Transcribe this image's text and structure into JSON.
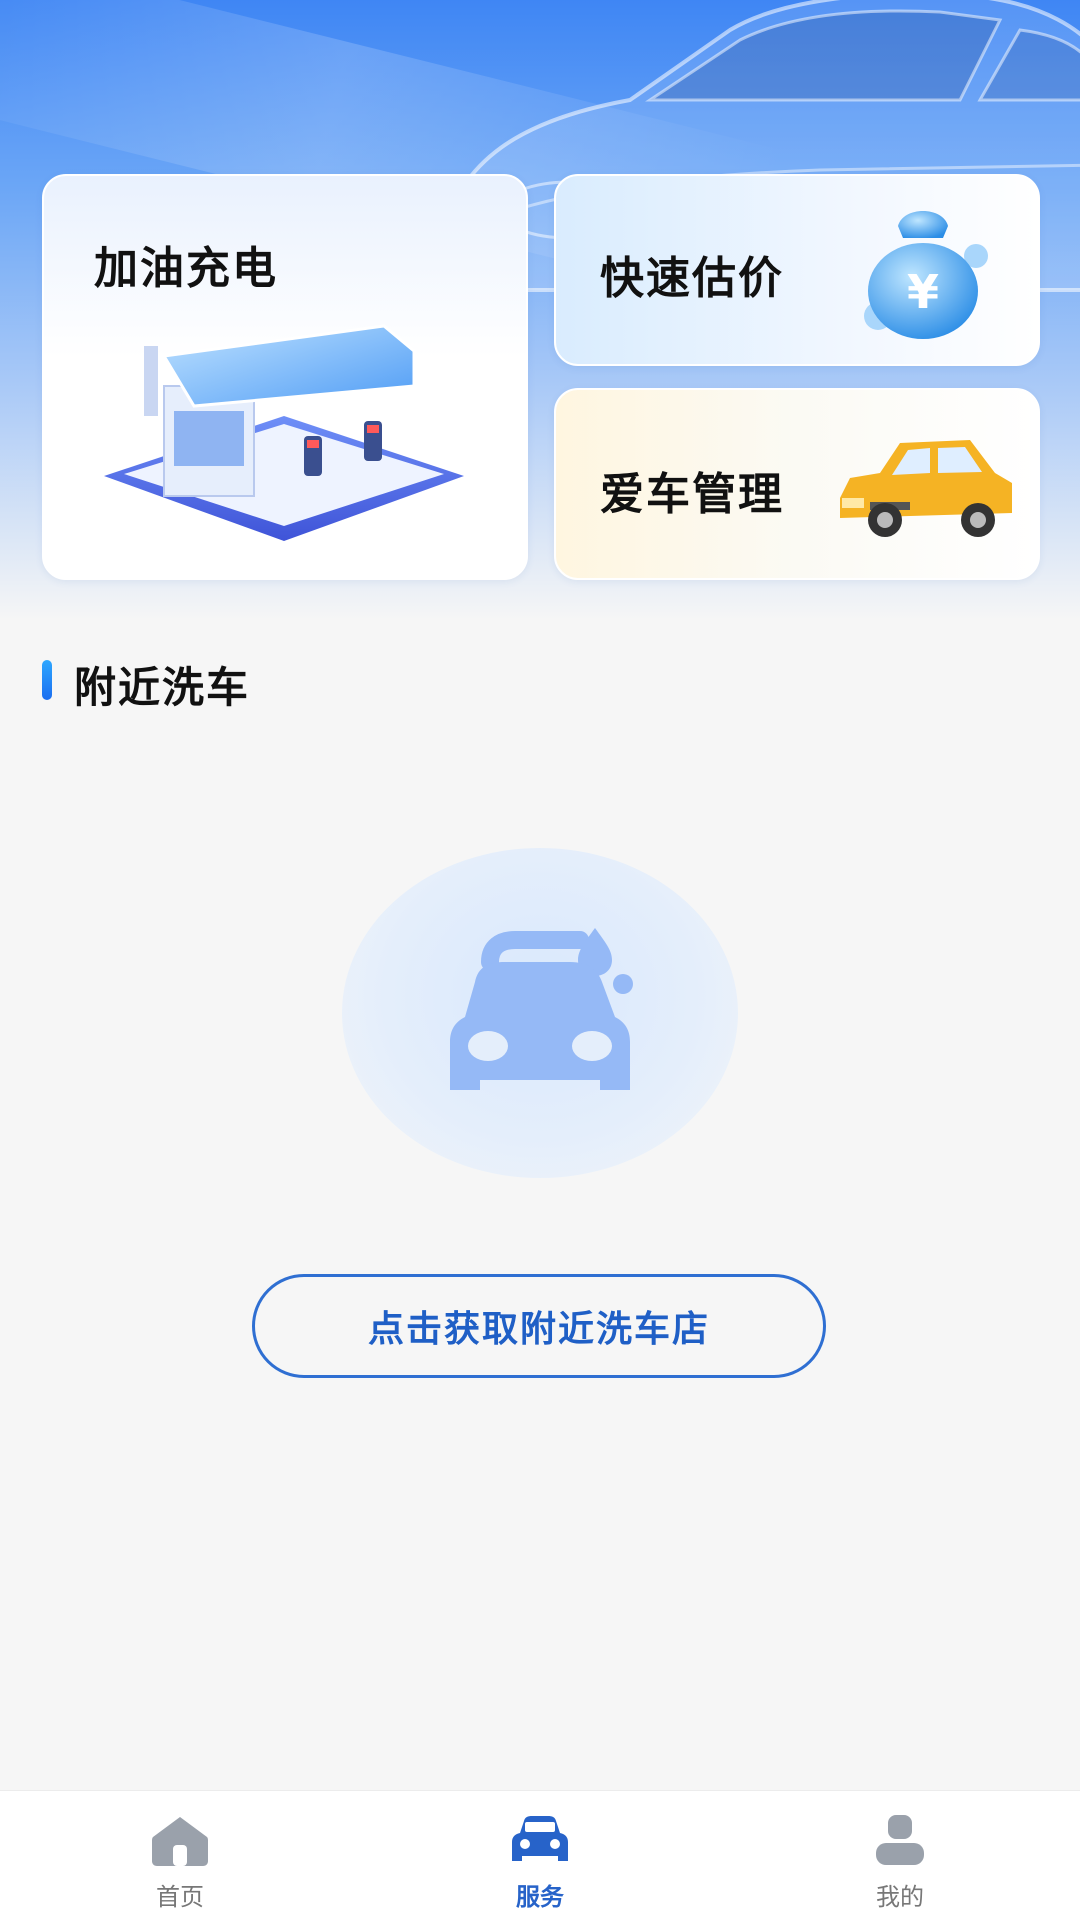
{
  "cards": {
    "fuel_charge": {
      "title": "加油充电",
      "icon": "gas-station-illustration"
    },
    "quick_valuation": {
      "title": "快速估价",
      "icon": "money-bag-yen-illustration"
    },
    "car_management": {
      "title": "爱车管理",
      "icon": "yellow-car-illustration"
    }
  },
  "nearby_wash": {
    "section_title": "附近洗车",
    "empty_icon": "car-wash-icon",
    "button_label": "点击获取附近洗车店"
  },
  "tabbar": {
    "items": [
      {
        "label": "首页",
        "icon": "home-icon",
        "active": false
      },
      {
        "label": "服务",
        "icon": "car-icon",
        "active": true
      },
      {
        "label": "我的",
        "icon": "user-icon",
        "active": false
      }
    ]
  },
  "colors": {
    "accent": "#2763c9",
    "hero_blue": "#3f86f4",
    "empty_icon": "#95b9f6",
    "tab_inactive": "#9aa1ab"
  }
}
